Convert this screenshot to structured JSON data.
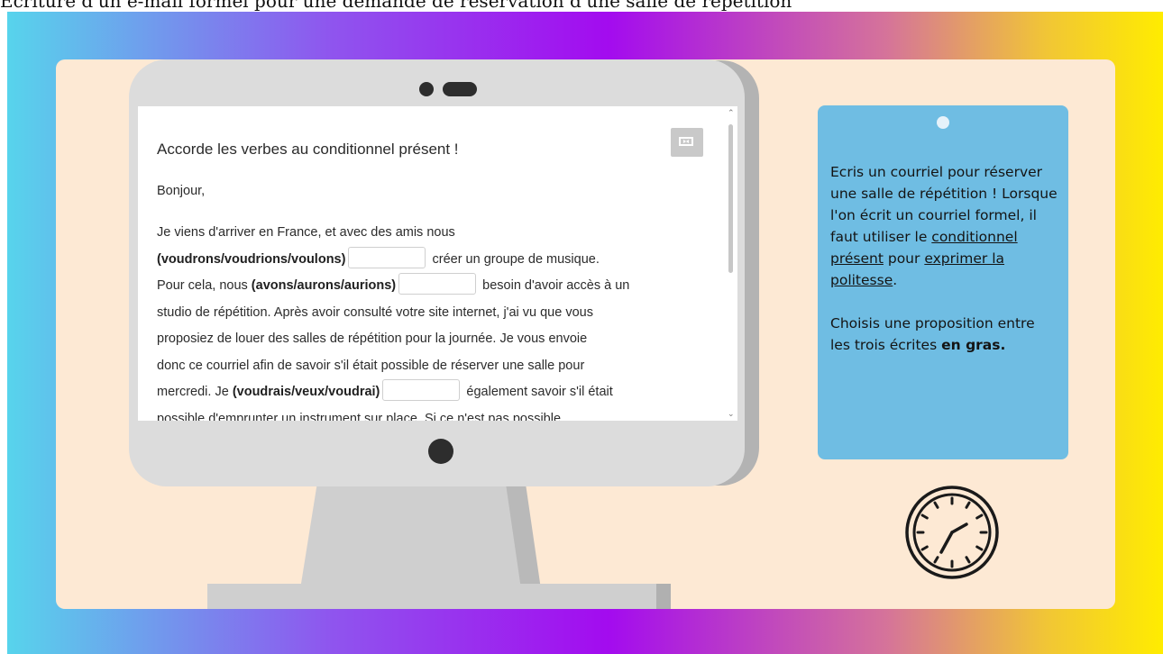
{
  "page_title": "Écriture d'un e-mail formel pour une demande de réservation d'une salle de répétition",
  "exercise": {
    "heading": "Accorde les verbes au conditionnel présent !",
    "greeting": "Bonjour,",
    "line1": "Je viens d'arriver en France, et avec des amis nous",
    "choice1": "(voudrons/voudrions/voulons)",
    "line2_after": "créer un groupe de musique.",
    "line3_before": "Pour cela, nous",
    "choice2": "(avons/aurons/aurions)",
    "line3_after": "besoin d'avoir accès à un",
    "line4": "studio de répétition. Après avoir consulté votre site internet, j'ai vu que vous",
    "line5": "proposiez de louer des salles de répétition pour la journée. Je vous envoie",
    "line6": "donc ce courriel afin de savoir s'il était possible de réserver une salle pour",
    "line7_before": "mercredi. Je",
    "choice3": "(voudrais/veux/voudrai)",
    "line7_after": "également savoir s'il était",
    "line8": "possible d'emprunter un instrument sur place. Si ce n'est pas possible,"
  },
  "instructions": {
    "p1_text1": "Ecris un courriel pour réserver une salle de répétition ! Lorsque l'on écrit un courriel formel, il faut utiliser le",
    "p1_link1": "conditionnel présent",
    "p1_text2": "pour",
    "p1_link2": "exprimer la politesse",
    "p1_end": ".",
    "p2_text": "Choisis une proposition entre les trois écrites",
    "p2_bold": "en gras."
  },
  "icons": {
    "expand": "expand-icon",
    "clock": "clock-icon",
    "webcam": "webcam-icon",
    "power": "power-button-icon"
  },
  "colors": {
    "card_bg": "#fde9d4",
    "panel_bg": "#6fbde3",
    "monitor_bezel": "#dcdcdc"
  }
}
